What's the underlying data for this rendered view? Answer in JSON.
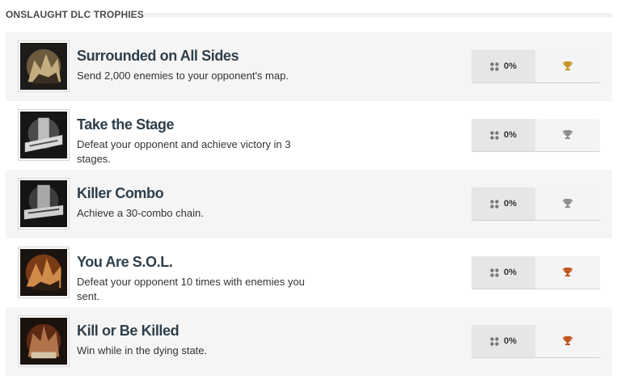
{
  "section": {
    "title": "ONSLAUGHT DLC TROPHIES"
  },
  "trophies": [
    {
      "name": "Surrounded on All Sides",
      "description": "Send 2,000 enemies to your opponent's map.",
      "rarity": "0%",
      "tier": "gold",
      "tier_color": "#c9932c"
    },
    {
      "name": "Take the Stage",
      "description": "Defeat your opponent and achieve victory in 3 stages.",
      "rarity": "0%",
      "tier": "silver",
      "tier_color": "#8e8e8e"
    },
    {
      "name": "Killer Combo",
      "description": "Achieve a 30-combo chain.",
      "rarity": "0%",
      "tier": "silver",
      "tier_color": "#8e8e8e"
    },
    {
      "name": "You Are S.O.L.",
      "description": "Defeat your opponent 10 times with enemies you sent.",
      "rarity": "0%",
      "tier": "bronze",
      "tier_color": "#c2561e"
    },
    {
      "name": "Kill or Be Killed",
      "description": "Win while in the dying state.",
      "rarity": "0%",
      "tier": "bronze",
      "tier_color": "#c2561e"
    }
  ]
}
